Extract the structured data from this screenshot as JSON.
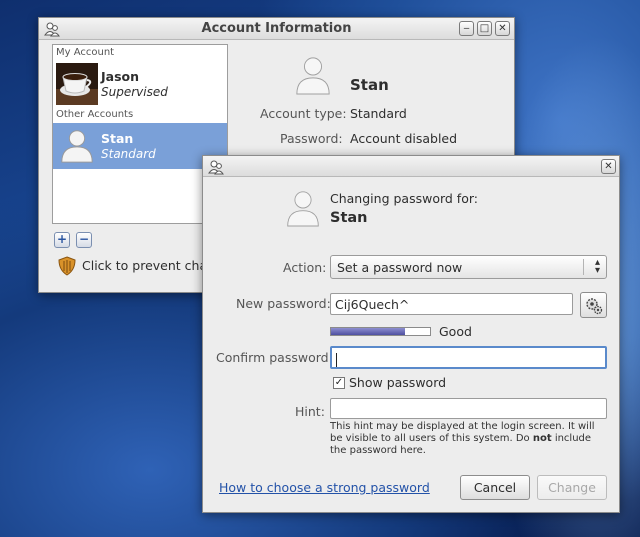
{
  "account_window": {
    "title": "Account Information",
    "controls": {
      "minimize": "‒",
      "maximize": "□",
      "close": "✕"
    },
    "sections": {
      "my_account": "My Account",
      "other_accounts": "Other Accounts"
    },
    "accounts": [
      {
        "name": "Jason",
        "type": "Supervised",
        "selected": false,
        "icon": "coffee-cup-avatar-icon"
      },
      {
        "name": "Stan",
        "type": "Standard",
        "selected": true,
        "icon": "user-silhouette-icon"
      }
    ],
    "add_label": "+",
    "remove_label": "−",
    "lock_text": "Click to prevent chang",
    "detail": {
      "name": "Stan",
      "account_type_label": "Account type:",
      "account_type_value": "Standard",
      "password_label": "Password:",
      "password_value": "Account disabled"
    }
  },
  "password_dialog": {
    "close": "✕",
    "heading": "Changing password for:",
    "user_name": "Stan",
    "action_label": "Action:",
    "action_value": "Set a password now",
    "action_arrow_up": "▴",
    "action_arrow_down": "▾",
    "new_password_label": "New password:",
    "new_password_value": "Cij6Quech^",
    "generate_icon": "gears-icon",
    "strength": {
      "level": 0.75,
      "label": "Good"
    },
    "confirm_label": "Confirm password:",
    "confirm_value": "",
    "show_password_label": "Show password",
    "show_password_checked": "✓",
    "hint_label": "Hint:",
    "hint_value": "",
    "hint_help_part1": "This hint may be displayed at the login screen.  It will be visible to all users of this system.  Do ",
    "hint_help_bold": "not",
    "hint_help_part2": " include the password here.",
    "strong_password_link": "How to choose a strong password",
    "cancel_label": "Cancel",
    "change_label": "Change"
  },
  "colors": {
    "selection": "#7aa0d8",
    "link": "#2352a8",
    "focus_border": "#5a8acb",
    "strength_fill": "#5d5fa8"
  }
}
